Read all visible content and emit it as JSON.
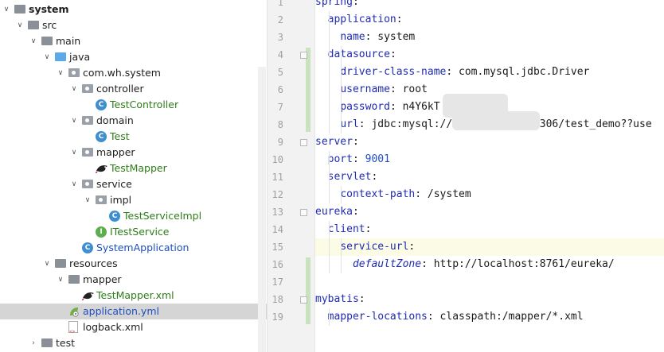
{
  "project_tree": {
    "items": [
      {
        "label": "system",
        "depth": 0,
        "expanded": true,
        "kind": "module",
        "style": "bold"
      },
      {
        "label": "src",
        "depth": 1,
        "expanded": true,
        "kind": "folder"
      },
      {
        "label": "main",
        "depth": 2,
        "expanded": true,
        "kind": "folder"
      },
      {
        "label": "java",
        "depth": 3,
        "expanded": true,
        "kind": "folder-blue"
      },
      {
        "label": "com.wh.system",
        "depth": 4,
        "expanded": true,
        "kind": "package"
      },
      {
        "label": "controller",
        "depth": 5,
        "expanded": true,
        "kind": "package"
      },
      {
        "label": "TestController",
        "depth": 6,
        "kind": "class",
        "style": "green"
      },
      {
        "label": "domain",
        "depth": 5,
        "expanded": true,
        "kind": "package"
      },
      {
        "label": "Test",
        "depth": 6,
        "kind": "class",
        "style": "green"
      },
      {
        "label": "mapper",
        "depth": 5,
        "expanded": true,
        "kind": "package"
      },
      {
        "label": "TestMapper",
        "depth": 6,
        "kind": "mybatis",
        "style": "green"
      },
      {
        "label": "service",
        "depth": 5,
        "expanded": true,
        "kind": "package"
      },
      {
        "label": "impl",
        "depth": 6,
        "expanded": true,
        "kind": "package"
      },
      {
        "label": "TestServiceImpl",
        "depth": 7,
        "kind": "class",
        "style": "green"
      },
      {
        "label": "ITestService",
        "depth": 6,
        "kind": "interface",
        "style": "green"
      },
      {
        "label": "SystemApplication",
        "depth": 5,
        "kind": "class",
        "style": "blue"
      },
      {
        "label": "resources",
        "depth": 3,
        "expanded": true,
        "kind": "folder"
      },
      {
        "label": "mapper",
        "depth": 4,
        "expanded": true,
        "kind": "folder"
      },
      {
        "label": "TestMapper.xml",
        "depth": 5,
        "kind": "mybatis",
        "style": "green"
      },
      {
        "label": "application.yml",
        "depth": 4,
        "kind": "yml",
        "style": "blue",
        "selected": true
      },
      {
        "label": "logback.xml",
        "depth": 4,
        "kind": "xml"
      },
      {
        "label": "test",
        "depth": 2,
        "expanded": false,
        "kind": "folder"
      }
    ]
  },
  "editor": {
    "line_numbers": [
      "1",
      "2",
      "3",
      "4",
      "5",
      "6",
      "7",
      "8",
      "9",
      "10",
      "11",
      "12",
      "13",
      "14",
      "15",
      "16",
      "17",
      "18",
      "19"
    ],
    "current_line": 15,
    "lines": [
      [
        {
          "t": "spring",
          "c": "k"
        },
        {
          "t": ":",
          "c": ""
        }
      ],
      [
        {
          "t": "  ",
          "c": ""
        },
        {
          "t": "application",
          "c": "k"
        },
        {
          "t": ":",
          "c": ""
        }
      ],
      [
        {
          "t": "    ",
          "c": ""
        },
        {
          "t": "name",
          "c": "k"
        },
        {
          "t": ": system",
          "c": ""
        }
      ],
      [
        {
          "t": "  ",
          "c": ""
        },
        {
          "t": "datasource",
          "c": "k"
        },
        {
          "t": ":",
          "c": ""
        }
      ],
      [
        {
          "t": "    ",
          "c": ""
        },
        {
          "t": "driver-class-name",
          "c": "k"
        },
        {
          "t": ": com.mysql.jdbc.Driver",
          "c": ""
        }
      ],
      [
        {
          "t": "    ",
          "c": ""
        },
        {
          "t": "username",
          "c": "k"
        },
        {
          "t": ": root",
          "c": ""
        }
      ],
      [
        {
          "t": "    ",
          "c": ""
        },
        {
          "t": "password",
          "c": "k"
        },
        {
          "t": ": n4Y6kT",
          "c": ""
        }
      ],
      [
        {
          "t": "    ",
          "c": ""
        },
        {
          "t": "url",
          "c": "k"
        },
        {
          "t": ": jdbc:mysql://",
          "c": ""
        },
        {
          "t": "           ",
          "c": ""
        },
        {
          "t": "4:3306/test_demo??use",
          "c": ""
        }
      ],
      [
        {
          "t": "server",
          "c": "k"
        },
        {
          "t": ":",
          "c": ""
        }
      ],
      [
        {
          "t": "  ",
          "c": ""
        },
        {
          "t": "port",
          "c": "k"
        },
        {
          "t": ": ",
          "c": ""
        },
        {
          "t": "9001",
          "c": "n"
        }
      ],
      [
        {
          "t": "  ",
          "c": ""
        },
        {
          "t": "servlet",
          "c": "k"
        },
        {
          "t": ":",
          "c": ""
        }
      ],
      [
        {
          "t": "    ",
          "c": ""
        },
        {
          "t": "context-path",
          "c": "k"
        },
        {
          "t": ": /system",
          "c": ""
        }
      ],
      [
        {
          "t": "eureka",
          "c": "k"
        },
        {
          "t": ":",
          "c": ""
        }
      ],
      [
        {
          "t": "  ",
          "c": ""
        },
        {
          "t": "client",
          "c": "k"
        },
        {
          "t": ":",
          "c": ""
        }
      ],
      [
        {
          "t": "    ",
          "c": ""
        },
        {
          "t": "service-url",
          "c": "k"
        },
        {
          "t": ":",
          "c": ""
        }
      ],
      [
        {
          "t": "      ",
          "c": ""
        },
        {
          "t": "defaultZone",
          "c": "it"
        },
        {
          "t": ": http://localhost:8761/eureka/",
          "c": ""
        }
      ],
      [],
      [
        {
          "t": "mybatis",
          "c": "k"
        },
        {
          "t": ":",
          "c": ""
        }
      ],
      [
        {
          "t": "  ",
          "c": ""
        },
        {
          "t": "mapper-locations",
          "c": "k"
        },
        {
          "t": ": classpath:/mapper/*.xml",
          "c": ""
        }
      ]
    ]
  },
  "colors": {
    "keyword": "#1f2bb0",
    "number": "#1f4ec2",
    "class_green": "#2e7d1a",
    "selection": "#d5d5d5",
    "gutter": "#f2f2f2",
    "change_marker": "#c9e2c0",
    "current_line": "#fbfbe6"
  }
}
